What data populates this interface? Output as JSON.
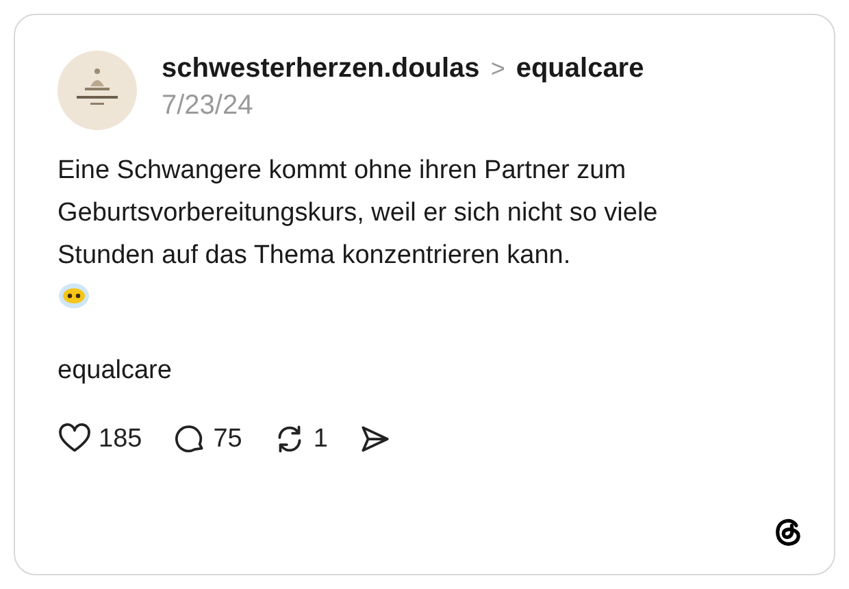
{
  "post": {
    "author": "schwesterherzen.doulas",
    "separator": ">",
    "topic": "equalcare",
    "date": "7/23/24",
    "body": "Eine Schwangere kommt ohne ihren Partner zum Geburtsvorbereitungskurs, weil er sich nicht so viele Stunden auf das Thema konzentrieren kann.",
    "tag": "equalcare",
    "actions": [
      {
        "kind": "like",
        "count": "185"
      },
      {
        "kind": "reply",
        "count": "75"
      },
      {
        "kind": "repost",
        "count": "1"
      },
      {
        "kind": "share"
      }
    ]
  }
}
